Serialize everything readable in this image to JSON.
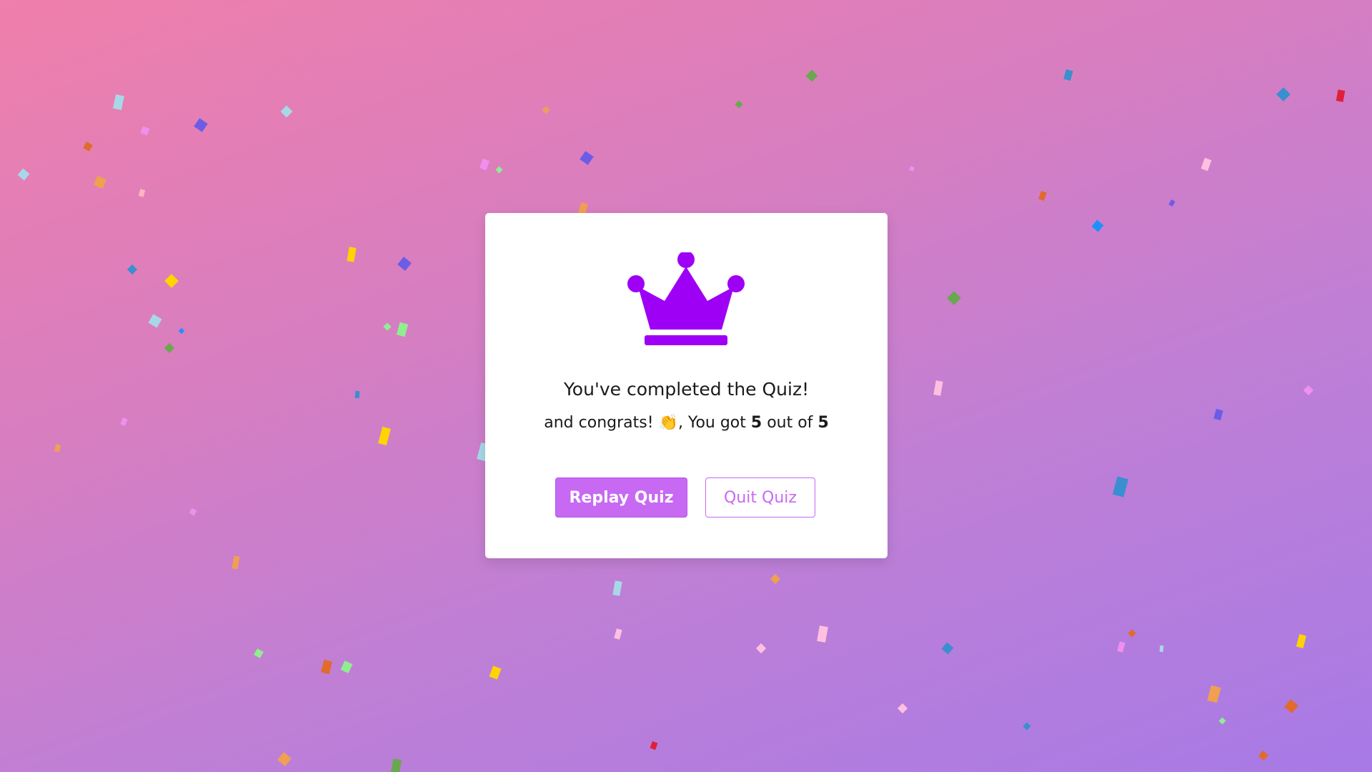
{
  "result": {
    "title": "You've completed the Quiz!",
    "congrats_prefix": "and congrats!",
    "congrats_emoji": "👏",
    "score_prefix": ", You got",
    "score": "5",
    "score_middle": "out of",
    "total": "5"
  },
  "buttons": {
    "replay_label": "Replay Quiz",
    "quit_label": "Quit Quiz"
  },
  "icons": {
    "crown": "crown-icon"
  },
  "colors": {
    "accent": "#9d00f5",
    "button_fill": "#c769f3",
    "card_background": "#ffffff",
    "background_start": "#ef7fab",
    "background_end": "#a77ae6"
  }
}
